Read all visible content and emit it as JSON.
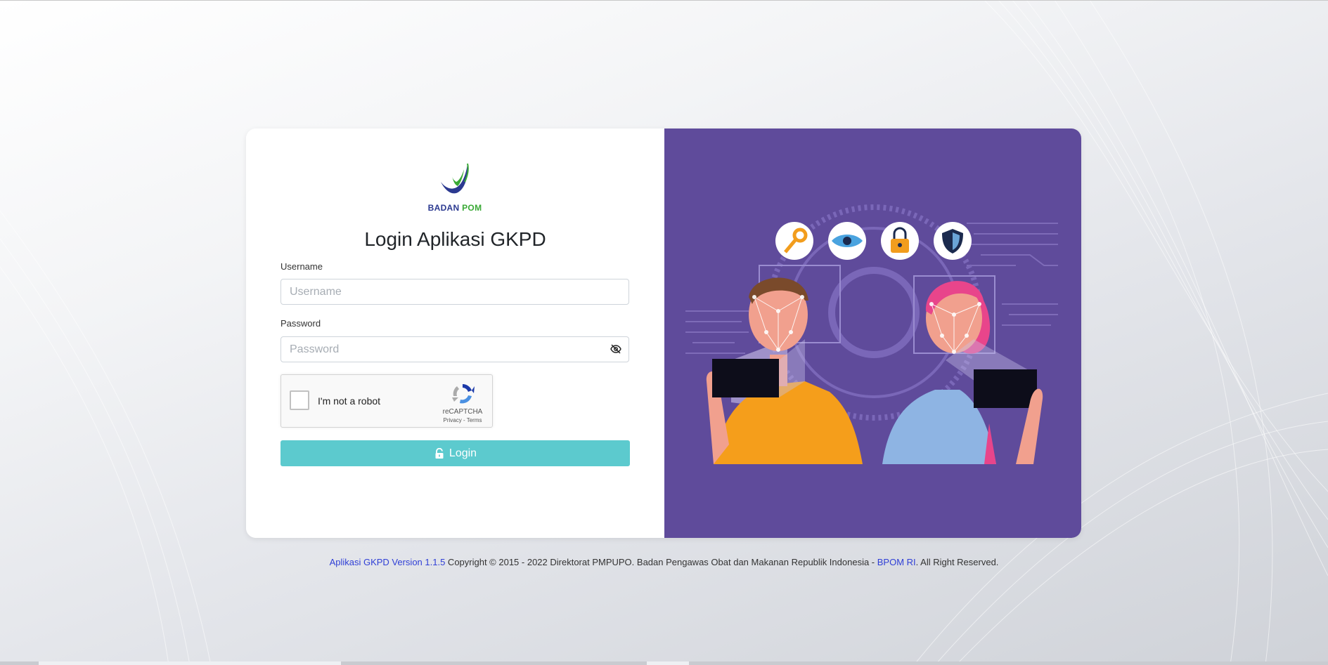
{
  "app": {
    "logo_text_1": "BADAN",
    "logo_text_2": "POM",
    "title": "Login Aplikasi GKPD"
  },
  "form": {
    "username_label": "Username",
    "username_placeholder": "Username",
    "username_value": "",
    "password_label": "Password",
    "password_placeholder": "Password",
    "password_value": "",
    "login_label": "Login"
  },
  "captcha": {
    "label": "I'm not a robot",
    "brand": "reCAPTCHA",
    "privacy": "Privacy",
    "separator": " - ",
    "terms": "Terms",
    "checked": false
  },
  "footer": {
    "version_link": "Aplikasi GKPD Version 1.1.5",
    "copyright": " Copyright © 2015 - 2022 Direktorat PMPUPO. Badan Pengawas Obat dan Makanan Republik Indonesia - ",
    "bpom_link": "BPOM RI",
    "rights": ". All Right Reserved."
  },
  "colors": {
    "accent": "#5ccace",
    "panel": "#5f4b9b",
    "logo_blue": "#2b3990",
    "logo_green": "#39a935",
    "link": "#2f3fd6"
  },
  "icons": [
    "eye-off-icon",
    "unlock-icon",
    "recaptcha-icon",
    "key-icon",
    "eye-icon",
    "padlock-icon",
    "shield-icon"
  ]
}
